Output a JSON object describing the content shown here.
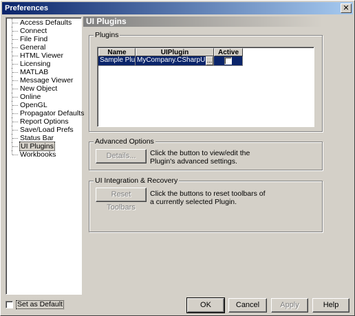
{
  "window": {
    "title": "Preferences",
    "close_glyph": "✕"
  },
  "sidebar": {
    "items": [
      {
        "label": "Access Defaults"
      },
      {
        "label": "Connect"
      },
      {
        "label": "File Find"
      },
      {
        "label": "General"
      },
      {
        "label": "HTML Viewer"
      },
      {
        "label": "Licensing"
      },
      {
        "label": "MATLAB"
      },
      {
        "label": "Message Viewer"
      },
      {
        "label": "New Object"
      },
      {
        "label": "Online"
      },
      {
        "label": "OpenGL"
      },
      {
        "label": "Propagator Defaults"
      },
      {
        "label": "Report Options"
      },
      {
        "label": "Save/Load Prefs"
      },
      {
        "label": "Status Bar"
      },
      {
        "label": "UI Plugins",
        "selected": true
      },
      {
        "label": "Workbooks"
      }
    ]
  },
  "page": {
    "title": "UI Plugins"
  },
  "plugins_group": {
    "label": "Plugins",
    "columns": [
      "Name",
      "UIPlugin",
      "Active"
    ],
    "rows": [
      {
        "name": "Sample Plugin",
        "uiplugin": "MyCompany.CSharpUIPlugin",
        "ellipsis": "...",
        "active": false
      }
    ]
  },
  "advanced_group": {
    "label": "Advanced Options",
    "button": "Details...",
    "description": [
      "Click the button to view/edit the",
      "Plugin's advanced settings."
    ]
  },
  "integration_group": {
    "label": "UI Integration & Recovery",
    "button": "Reset Toolbars",
    "description": [
      "Click the buttons to reset toolbars of",
      "a currently selected Plugin."
    ]
  },
  "footer": {
    "set_default": "Set as Default",
    "ok": "OK",
    "cancel": "Cancel",
    "apply": "Apply",
    "help": "Help"
  }
}
